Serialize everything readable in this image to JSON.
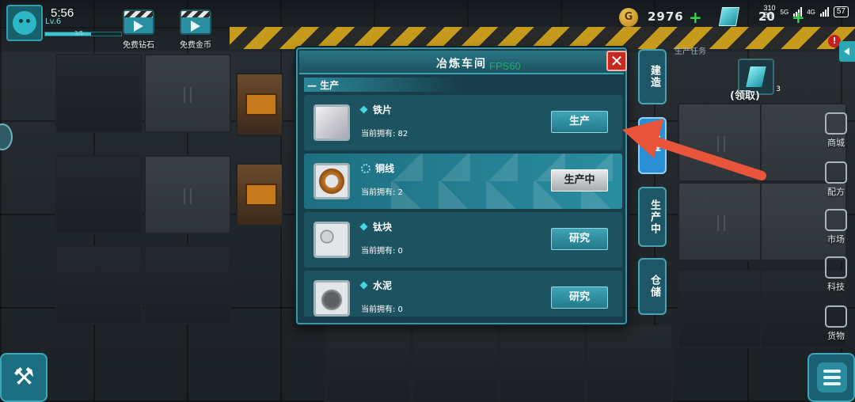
{
  "status_bar": {
    "time": "5:56",
    "net_speed": "310\nB/s",
    "net1": "5G",
    "net2": "4G",
    "battery": "57"
  },
  "player": {
    "level": "Lv.6",
    "xp": "3/5",
    "xp_fraction": 0.6
  },
  "rewards": [
    {
      "label": "免费钻石",
      "icon": "video-clapper-icon"
    },
    {
      "label": "免费金币",
      "icon": "video-clapper-icon"
    }
  ],
  "currency": {
    "coins": "2976",
    "coin_symbol": "G",
    "gems": "20"
  },
  "task": {
    "label": "生产任务",
    "claim": "(领取)",
    "count": "3"
  },
  "sidebar": [
    {
      "label": "商城",
      "icon": "cart-icon"
    },
    {
      "label": "配方",
      "icon": "recipe-icon"
    },
    {
      "label": "市场",
      "icon": "market-icon"
    },
    {
      "label": "科技",
      "icon": "tech-icon"
    },
    {
      "label": "货物",
      "icon": "cargo-icon"
    }
  ],
  "dialog": {
    "title": "冶炼车间",
    "fps": "FPS60",
    "close": "✕",
    "section": "— 生产",
    "items": [
      {
        "name": "铁片",
        "owned": "当前拥有: 82",
        "button": "生产",
        "busy": false
      },
      {
        "name": "铜线",
        "owned": "当前拥有: 2",
        "button": "生产中",
        "busy": true
      },
      {
        "name": "钛块",
        "owned": "当前拥有: 0",
        "button": "研究",
        "busy": false
      },
      {
        "name": "水泥",
        "owned": "当前拥有: 0",
        "button": "研究",
        "busy": false
      }
    ],
    "tabs": [
      {
        "label": "建造"
      },
      {
        "label": "生产"
      },
      {
        "label": "生产中"
      },
      {
        "label": "仓储"
      }
    ]
  },
  "colors": {
    "accent": "#2aa7b3",
    "hazard": "#d8a81c",
    "arrow": "#e8553a",
    "close": "#c52a20"
  }
}
